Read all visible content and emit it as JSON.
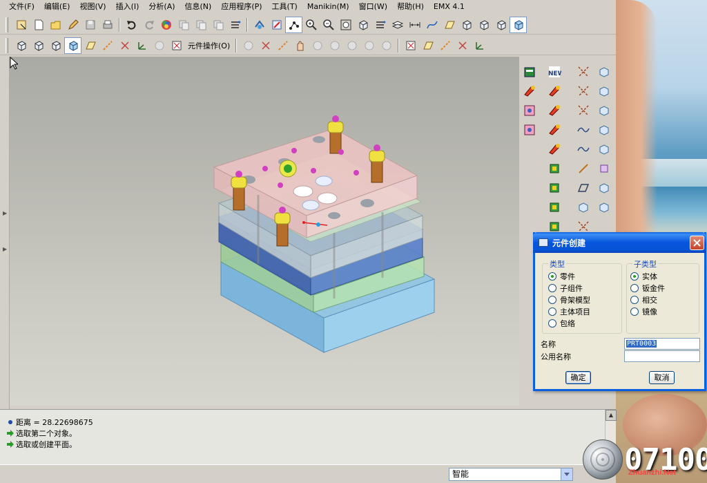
{
  "menubar": {
    "items": [
      "文件(F)",
      "编辑(E)",
      "视图(V)",
      "插入(I)",
      "分析(A)",
      "信息(N)",
      "应用程序(P)",
      "工具(T)",
      "Manikin(M)",
      "窗口(W)",
      "帮助(H)",
      "EMX 4.1"
    ]
  },
  "toolbar2": {
    "component_operation_label": "元件操作(O)"
  },
  "messages": {
    "line1": "距离 = 28.22698675",
    "line2": "选取第二个对象。",
    "line3": "选取或创建平面。"
  },
  "statusbar": {
    "filter_value": "智能"
  },
  "dialog": {
    "title": "元件创建",
    "type_group_label": "类型",
    "type_options": [
      "零件",
      "子组件",
      "骨架模型",
      "主体项目",
      "包络"
    ],
    "type_selected": "零件",
    "subtype_group_label": "子类型",
    "subtype_options": [
      "实体",
      "钣金件",
      "相交",
      "镜像"
    ],
    "subtype_selected": "实体",
    "name_label": "名称",
    "name_value": "PRT0003",
    "common_name_label": "公用名称",
    "common_name_value": "",
    "ok_label": "确定",
    "cancel_label": "取消"
  },
  "watermark": {
    "code": "07100",
    "site": "Zhuanzhi.Net"
  },
  "colors": {
    "dialog_title_blue": "#0a5ee0",
    "radio_checked": "#21a121",
    "selection_blue": "#316ac5"
  }
}
